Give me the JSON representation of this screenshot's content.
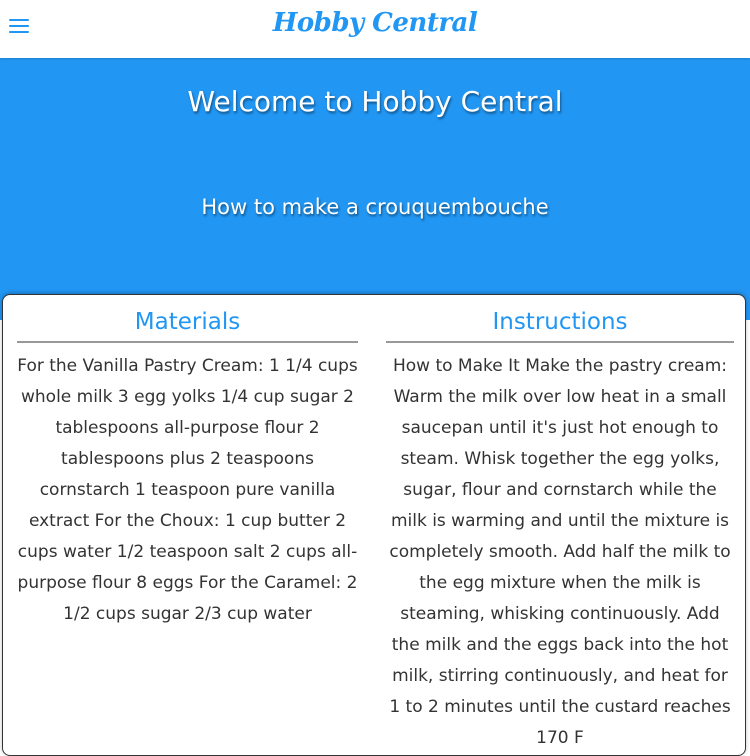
{
  "header": {
    "brand": "Hobby Central",
    "menu_icon": "hamburger-menu-icon"
  },
  "hero": {
    "title": "Welcome to Hobby Central",
    "subtitle": "How to make a crouquembouche"
  },
  "materials": {
    "heading": "Materials",
    "text": "For the Vanilla Pastry Cream: 1 1/4 cups whole milk 3 egg yolks 1/4 cup sugar 2 tablespoons all-purpose flour 2 tablespoons plus 2 teaspoons cornstarch 1 teaspoon pure vanilla extract For the Choux: 1 cup butter 2 cups water 1/2 teaspoon salt 2 cups all-purpose flour 8 eggs For the Caramel: 2 1/2 cups sugar 2/3 cup water"
  },
  "instructions": {
    "heading": "Instructions",
    "text": "How to Make It Make the pastry cream: Warm the milk over low heat in a small saucepan until it's just hot enough to steam. Whisk together the egg yolks, sugar, flour and cornstarch while the milk is warming and until the mixture is completely smooth. Add half the milk to the egg mixture when the milk is steaming, whisking continuously. Add the milk and the eggs back into the hot milk, stirring continuously, and heat for 1 to 2 minutes until the custard reaches 170 F"
  },
  "colors": {
    "accent": "#2196F3",
    "text": "#333333",
    "background": "#ffffff"
  }
}
